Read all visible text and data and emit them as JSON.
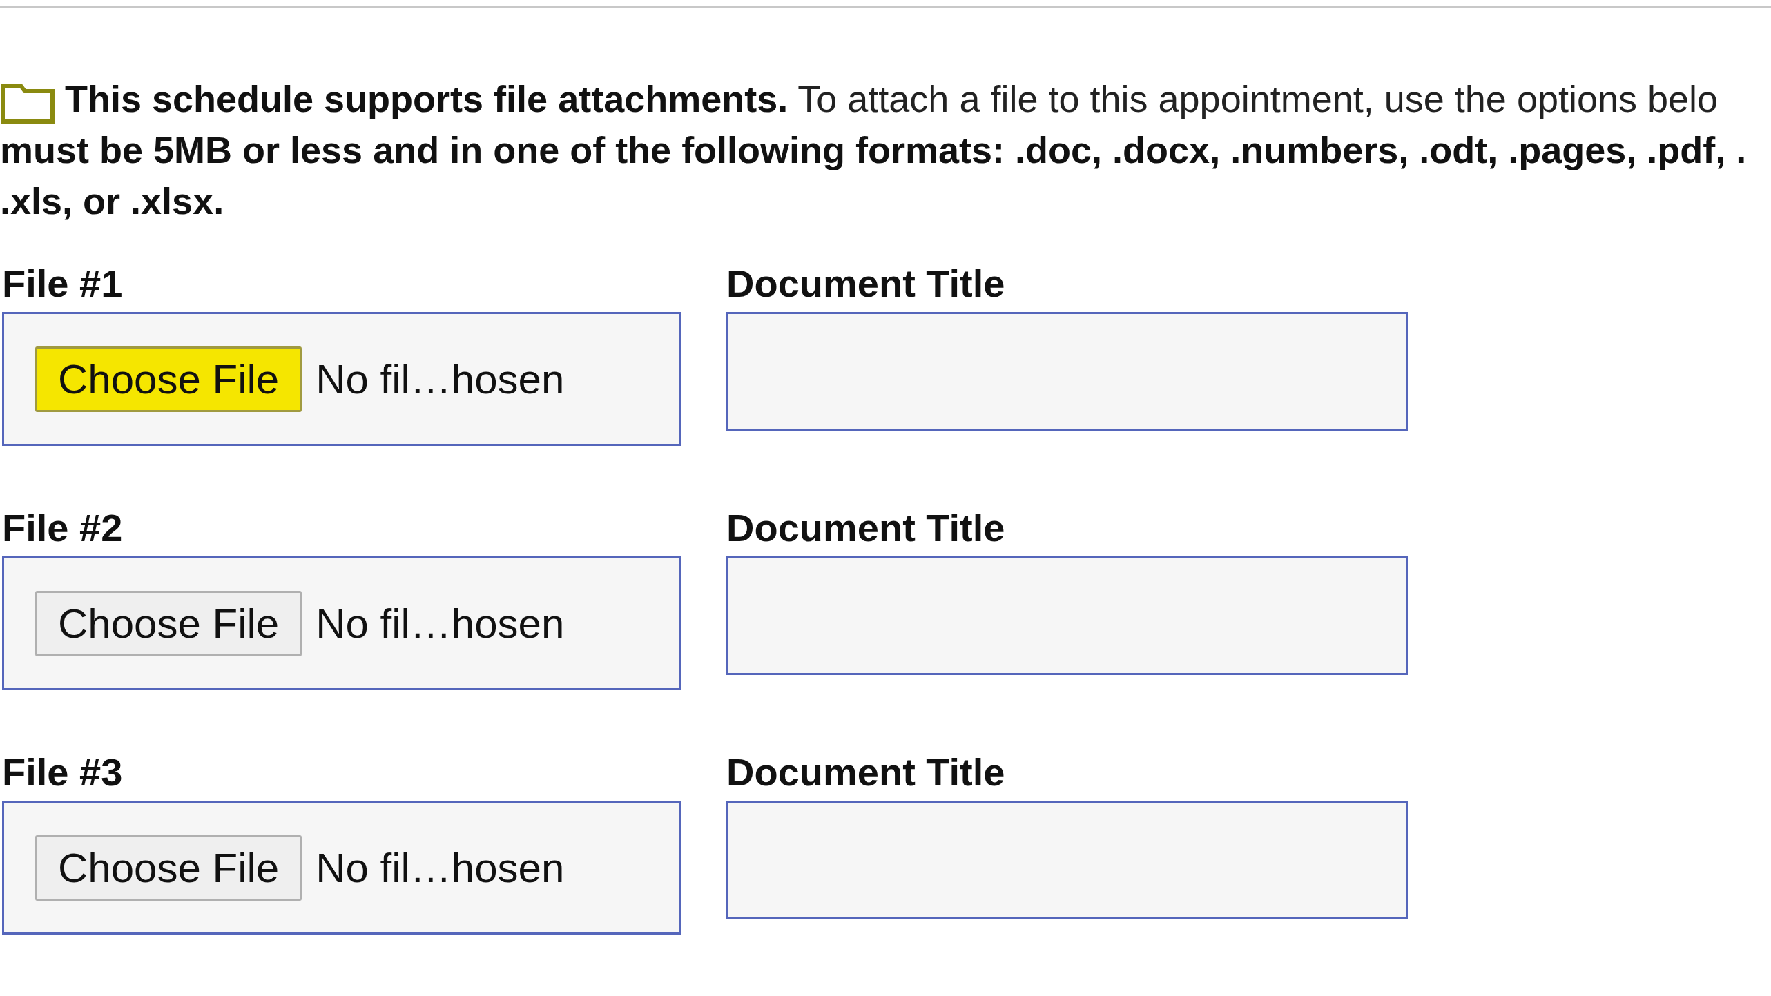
{
  "intro": {
    "lines": [
      "**This schedule supports file attachments.** To attach a file to this appointment, use the options belo",
      "**must be 5MB or less and in one of the following formats: .doc, .docx, .numbers, .odt, .pages, .pdf, .**",
      "**.xls, or .xlsx.**"
    ]
  },
  "attachments": [
    {
      "file_label": "File #1",
      "button": "Choose File",
      "status": "No fil…hosen",
      "highlighted": true,
      "title_label": "Document Title"
    },
    {
      "file_label": "File #2",
      "button": "Choose File",
      "status": "No fil…hosen",
      "highlighted": false,
      "title_label": "Document Title"
    },
    {
      "file_label": "File #3",
      "button": "Choose File",
      "status": "No fil…hosen",
      "highlighted": false,
      "title_label": "Document Title"
    }
  ]
}
